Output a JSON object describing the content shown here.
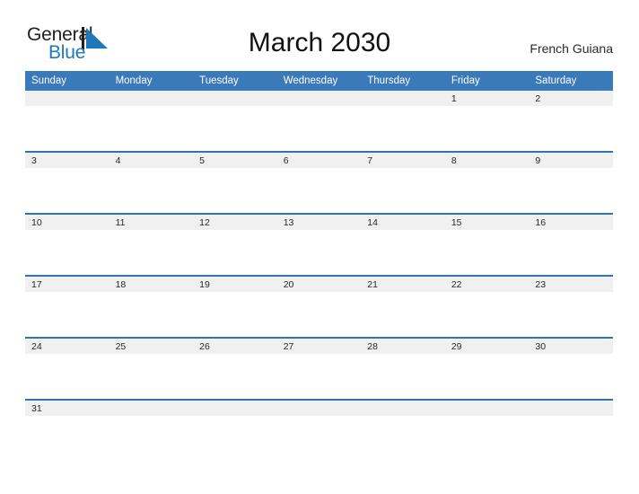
{
  "brand": {
    "name_part1": "General",
    "name_part2": "Blue",
    "triangle_icon": "triangle-icon",
    "color_dark": "#231f20",
    "color_blue": "#1f77bc"
  },
  "header": {
    "title": "March 2030",
    "location": "French Guiana"
  },
  "calendar": {
    "month": "March",
    "year": "2030",
    "accent_header_color": "#3a79ba",
    "row_line_color": "#2e74b5",
    "band_color": "#f0f0f0",
    "weekday_headers": [
      "Sunday",
      "Monday",
      "Tuesday",
      "Wednesday",
      "Thursday",
      "Friday",
      "Saturday"
    ],
    "weeks": [
      [
        "",
        "",
        "",
        "",
        "",
        "1",
        "2"
      ],
      [
        "3",
        "4",
        "5",
        "6",
        "7",
        "8",
        "9"
      ],
      [
        "10",
        "11",
        "12",
        "13",
        "14",
        "15",
        "16"
      ],
      [
        "17",
        "18",
        "19",
        "20",
        "21",
        "22",
        "23"
      ],
      [
        "24",
        "25",
        "26",
        "27",
        "28",
        "29",
        "30"
      ],
      [
        "31",
        "",
        "",
        "",
        "",
        "",
        ""
      ]
    ]
  }
}
